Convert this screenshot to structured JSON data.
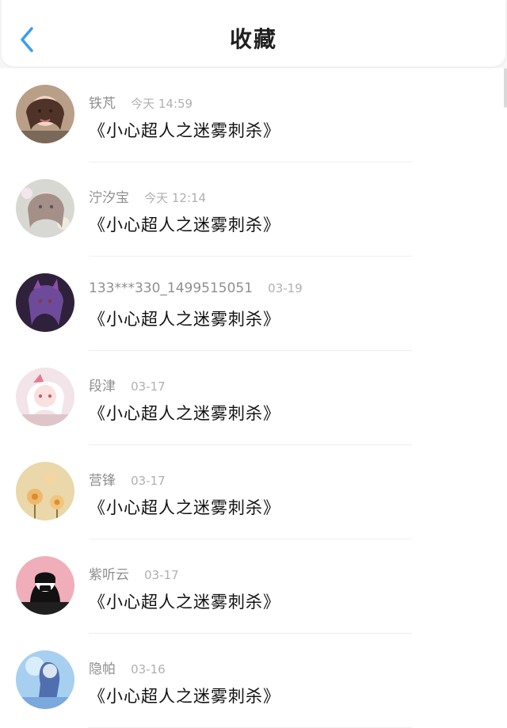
{
  "header": {
    "title": "收藏",
    "back_icon": "chevron-left-icon",
    "accent": "#3a9ef0"
  },
  "favorites": [
    {
      "name": "铁芃",
      "time": "今天 14:59",
      "title": "《小心超人之迷雾刺杀》",
      "avatar": "girl-portrait-avatar",
      "avatar_bg": "#c6a98f"
    },
    {
      "name": "泞汐宝",
      "time": "今天 12:14",
      "title": "《小心超人之迷雾刺杀》",
      "avatar": "anime-girl-floral-avatar",
      "avatar_bg": "#d8d8d2"
    },
    {
      "name": "133***330_1499515051",
      "time": "03-19",
      "title": "《小心超人之迷雾刺杀》",
      "avatar": "dark-anime-character-avatar",
      "avatar_bg": "#442a4d"
    },
    {
      "name": "段津",
      "time": "03-17",
      "title": "《小心超人之迷雾刺杀》",
      "avatar": "white-hair-anime-avatar",
      "avatar_bg": "#f0dde1"
    },
    {
      "name": "营锋",
      "time": "03-17",
      "title": "《小心超人之迷雾刺杀》",
      "avatar": "flower-field-avatar",
      "avatar_bg": "#e4c998"
    },
    {
      "name": "紫听云",
      "time": "03-17",
      "title": "《小心超人之迷雾刺杀》",
      "avatar": "masked-figure-avatar",
      "avatar_bg": "#efb2be"
    },
    {
      "name": "隐帕",
      "time": "03-16",
      "title": "《小心超人之迷雾刺杀》",
      "avatar": "blue-silhouette-avatar",
      "avatar_bg": "#9fc7ef"
    }
  ]
}
